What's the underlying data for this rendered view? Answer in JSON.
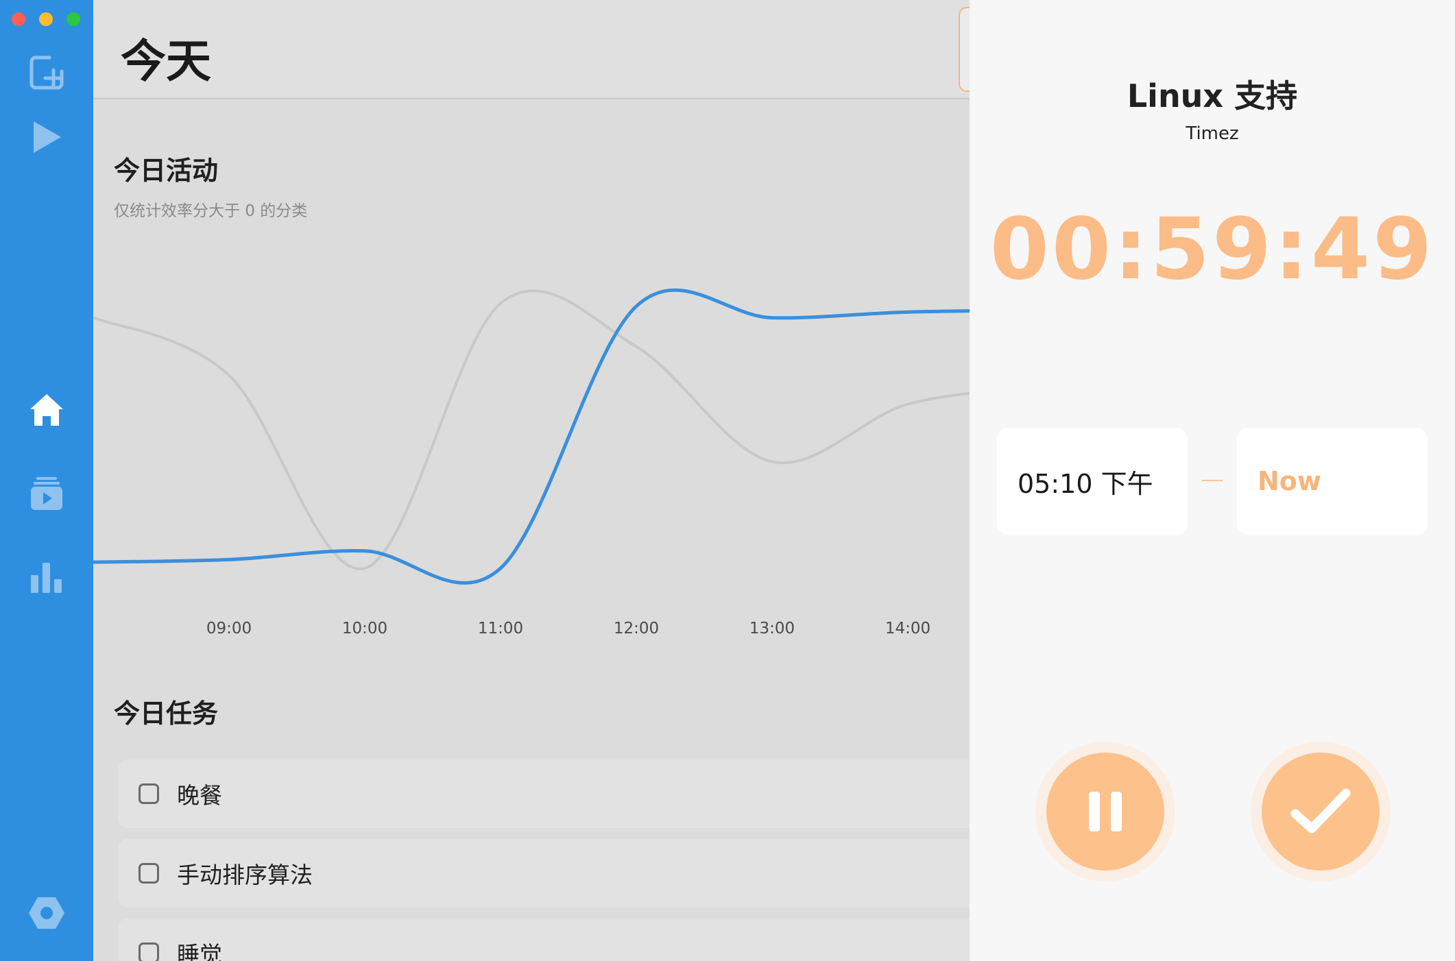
{
  "sidebar": {
    "icons": [
      "new-task-icon",
      "play-icon",
      "home-icon",
      "playlist-icon",
      "stats-icon",
      "settings-icon"
    ]
  },
  "header": {
    "title": "今天"
  },
  "activity": {
    "title": "今日活动",
    "subtitle": "仅统计效率分大于 0 的分类"
  },
  "chart_data": {
    "type": "line",
    "x": [
      "09:00",
      "10:00",
      "11:00",
      "12:00",
      "13:00",
      "14:00"
    ],
    "series": [
      {
        "color": "#3a8fdc",
        "values": [
          0.08,
          0.11,
          0.05,
          0.96,
          0.92,
          0.94
        ]
      },
      {
        "color": "#c8c8c8",
        "values": [
          0.72,
          0.05,
          0.97,
          0.82,
          0.42,
          0.62
        ]
      }
    ],
    "ylim": [
      0,
      1
    ],
    "grid": false
  },
  "tasks": {
    "title": "今日任务",
    "items": [
      {
        "label": "晚餐"
      },
      {
        "label": "手动排序算法"
      },
      {
        "label": "睡觉"
      }
    ]
  },
  "timer_panel": {
    "title": "Linux 支持",
    "subtitle": "Timez",
    "elapsed": "00:59:49",
    "start_time": "05:10 下午",
    "end_time": "Now",
    "accent_color": "#fbbc88"
  }
}
